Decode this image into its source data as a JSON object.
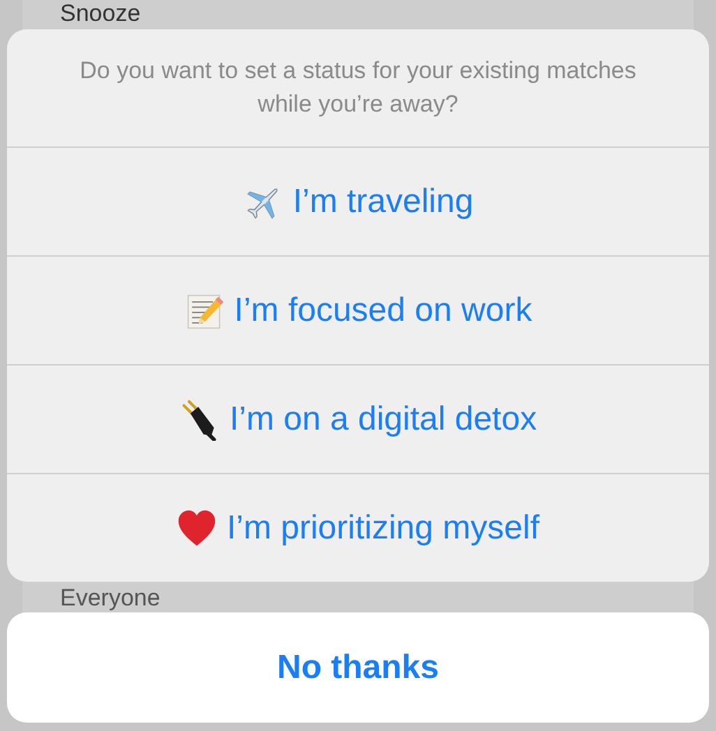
{
  "background": {
    "items": [
      "Snooze",
      "Everyone"
    ]
  },
  "action_sheet": {
    "message": "Do you want to set a status for your existing matches while you’re away?",
    "options": [
      {
        "kind": "airplane",
        "label": "I’m traveling"
      },
      {
        "kind": "memo",
        "label": "I’m focused on work"
      },
      {
        "kind": "plug",
        "label": "I’m on a digital detox"
      },
      {
        "kind": "heart",
        "label": "I’m prioritizing myself"
      }
    ]
  },
  "cancel_button": {
    "label": "No thanks"
  }
}
